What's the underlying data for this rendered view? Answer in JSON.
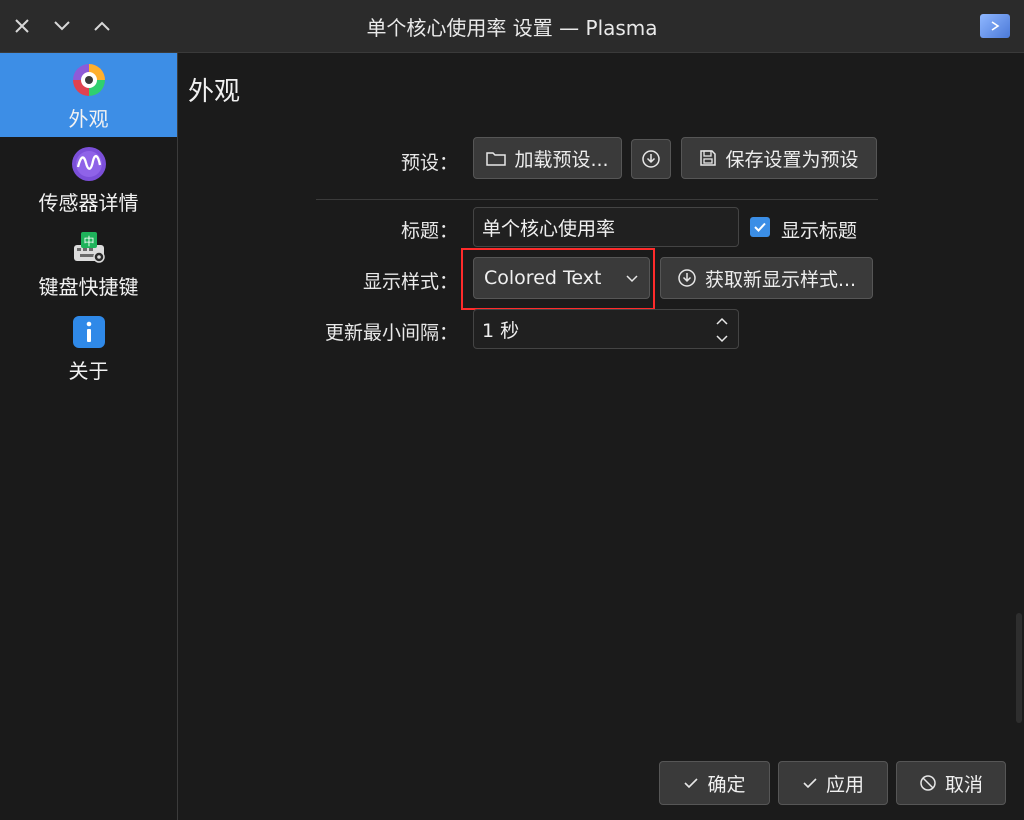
{
  "window": {
    "title": "单个核心使用率 设置 — Plasma",
    "icons": {
      "close": "close-icon",
      "minimize": "chevron-down-icon",
      "maximize": "chevron-up-icon",
      "app": "plasma-app-icon"
    }
  },
  "sidebar": {
    "items": [
      {
        "label": "外观",
        "icon": "appearance-icon",
        "active": true
      },
      {
        "label": "传感器详情",
        "icon": "sensor-icon",
        "active": false
      },
      {
        "label": "键盘快捷键",
        "icon": "keyboard-shortcuts-icon",
        "active": false
      },
      {
        "label": "关于",
        "icon": "info-icon",
        "active": false
      }
    ]
  },
  "main": {
    "page_title": "外观",
    "preset": {
      "label": "预设：",
      "load_button": "加载预设...",
      "download_icon": "download-icon",
      "save_button": "保存设置为预设"
    },
    "title_field": {
      "label": "标题：",
      "value": "单个核心使用率",
      "show_title_label": "显示标题",
      "show_title_checked": true
    },
    "display_style": {
      "label": "显示样式：",
      "selected": "Colored Text",
      "get_new_button": "获取新显示样式..."
    },
    "update_interval": {
      "label": "更新最小间隔：",
      "value": "1 秒"
    }
  },
  "footer": {
    "ok_button": "确定",
    "apply_button": "应用",
    "cancel_button": "取消"
  },
  "colors": {
    "accent": "#3d8ee6",
    "highlight_border": "#ff2b2b"
  }
}
